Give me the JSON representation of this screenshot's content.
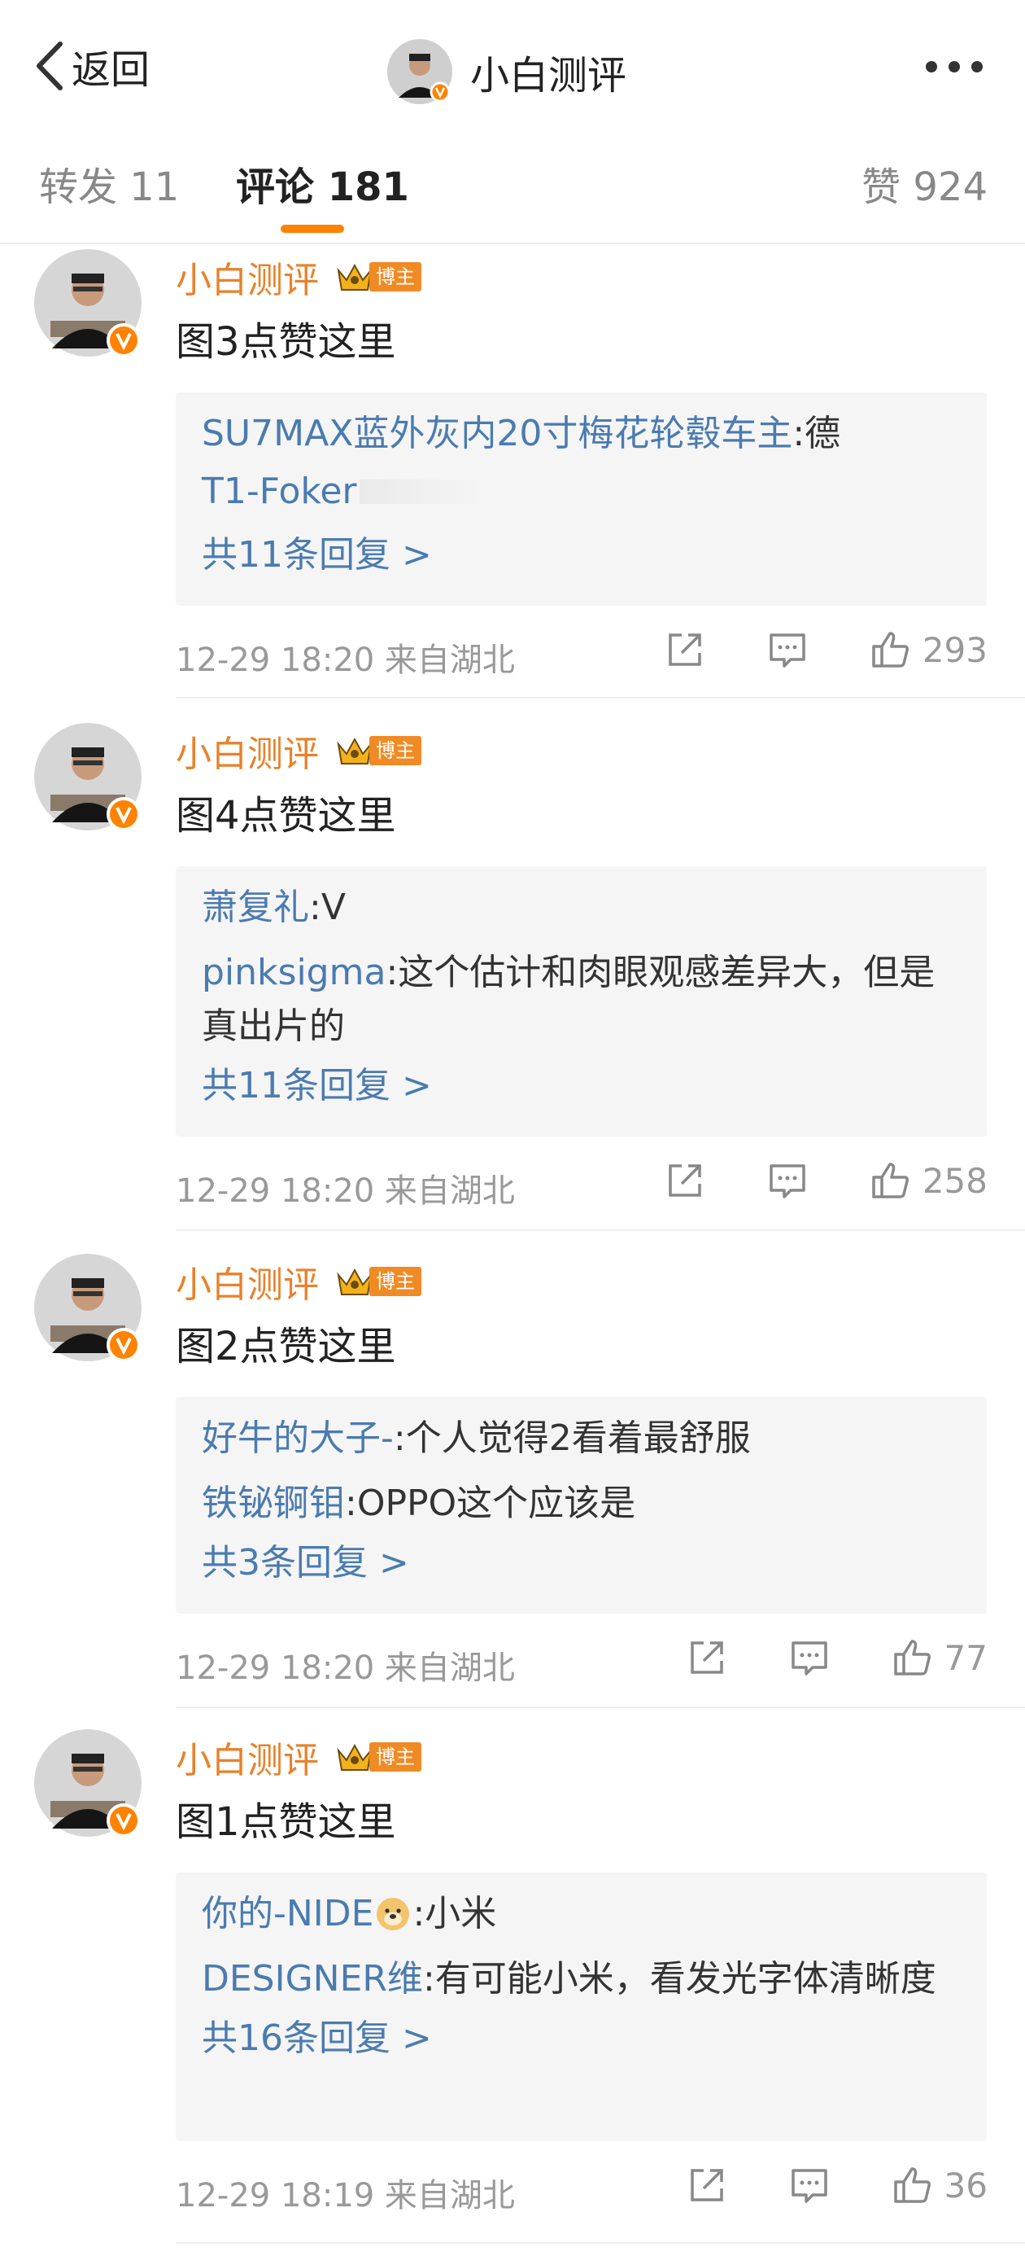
{
  "nav": {
    "back_label": "返回",
    "title": "小白测评"
  },
  "tabs": {
    "repost": "转发 11",
    "comment": "评论 181",
    "like": "赞 924"
  },
  "colors": {
    "accent": "#ff8200",
    "username": "#e8822b",
    "link": "#4a7bb0"
  },
  "comments": [
    {
      "user": "小白测评",
      "badge": "博主",
      "text": "图3点赞这里",
      "replies": [
        {
          "name": "SU7MAX蓝外灰内20寸梅花轮毂车主",
          "text": ":德"
        },
        {
          "name": "T1-Foker",
          "text": ""
        }
      ],
      "more": "共11条回复 >",
      "meta": "12-29 18:20 来自湖北",
      "likes": "293"
    },
    {
      "user": "小白测评",
      "badge": "博主",
      "text": "图4点赞这里",
      "replies": [
        {
          "name": "萧复礼",
          "text": ":V"
        },
        {
          "name": "pinksigma",
          "text": ":这个估计和肉眼观感差异大，但是真出片的"
        }
      ],
      "more": "共11条回复 >",
      "meta": "12-29 18:20 来自湖北",
      "likes": "258"
    },
    {
      "user": "小白测评",
      "badge": "博主",
      "text": "图2点赞这里",
      "replies": [
        {
          "name": "好牛的大子-",
          "text": ":个人觉得2看着最舒服"
        },
        {
          "name": "铁铋锕钼",
          "text": ":OPPO这个应该是"
        }
      ],
      "more": "共3条回复 >",
      "meta": "12-29 18:20 来自湖北",
      "likes": "77"
    },
    {
      "user": "小白测评",
      "badge": "博主",
      "text": "图1点赞这里",
      "replies": [
        {
          "name": "你的-NIDE",
          "text": ":小米"
        },
        {
          "name": "DESIGNER维",
          "text": ":有可能小米，看发光字体清晰度"
        }
      ],
      "more": "共16条回复 >",
      "meta": "12-29 18:19 来自湖北",
      "likes": "36"
    }
  ]
}
